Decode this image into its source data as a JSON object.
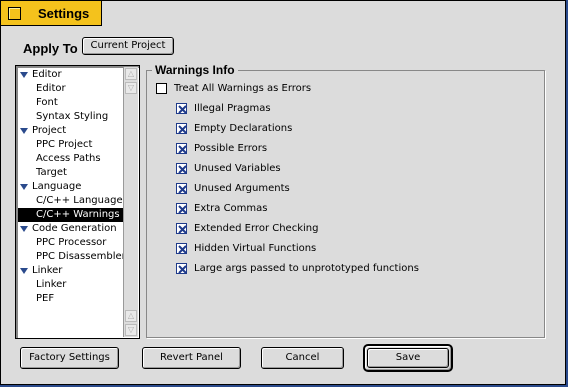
{
  "window": {
    "title": "Settings"
  },
  "apply_to": {
    "label": "Apply To",
    "button_label": "Current Project"
  },
  "sidebar": {
    "items": [
      {
        "label": "Editor",
        "type": "group"
      },
      {
        "label": "Editor",
        "type": "child"
      },
      {
        "label": "Font",
        "type": "child"
      },
      {
        "label": "Syntax Styling",
        "type": "child"
      },
      {
        "label": "Project",
        "type": "group"
      },
      {
        "label": "PPC Project",
        "type": "child"
      },
      {
        "label": "Access Paths",
        "type": "child"
      },
      {
        "label": "Target",
        "type": "child"
      },
      {
        "label": "Language",
        "type": "group"
      },
      {
        "label": "C/C++ Language",
        "type": "child"
      },
      {
        "label": "C/C++ Warnings",
        "type": "child",
        "selected": true
      },
      {
        "label": "Code Generation",
        "type": "group"
      },
      {
        "label": "PPC Processor",
        "type": "child"
      },
      {
        "label": "PPC Disassembler",
        "type": "child"
      },
      {
        "label": "Linker",
        "type": "group"
      },
      {
        "label": "Linker",
        "type": "child"
      },
      {
        "label": "PEF",
        "type": "child"
      }
    ]
  },
  "warnings": {
    "title": "Warnings Info",
    "treat_all": {
      "label": "Treat All Warnings as Errors",
      "checked": false
    },
    "options": [
      {
        "label": "Illegal Pragmas",
        "checked": true
      },
      {
        "label": "Empty Declarations",
        "checked": true
      },
      {
        "label": "Possible Errors",
        "checked": true
      },
      {
        "label": "Unused Variables",
        "checked": true
      },
      {
        "label": "Unused Arguments",
        "checked": true
      },
      {
        "label": "Extra Commas",
        "checked": true
      },
      {
        "label": "Extended Error Checking",
        "checked": true
      },
      {
        "label": "Hidden Virtual Functions",
        "checked": true
      },
      {
        "label": "Large args passed to unprototyped functions",
        "checked": true
      }
    ]
  },
  "buttons": {
    "factory": "Factory Settings",
    "revert": "Revert Panel",
    "cancel": "Cancel",
    "save": "Save"
  },
  "colors": {
    "title_tab": "#f4c21c",
    "accent_blue": "#2a4a8c",
    "window_bg": "#dcdcdc"
  }
}
